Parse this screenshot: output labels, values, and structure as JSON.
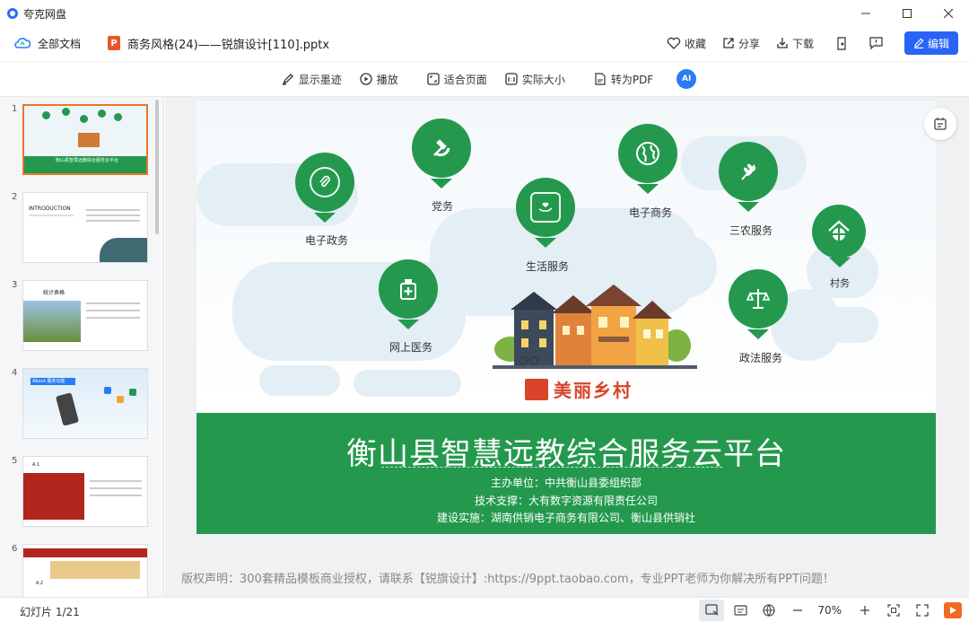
{
  "window": {
    "app_title": "夸克网盘"
  },
  "toolbar": {
    "breadcrumb": "全部文档",
    "filename": "商务风格(24)——锐旗设计[110].pptx",
    "file_type_badge": "P",
    "favorite_label": "收藏",
    "share_label": "分享",
    "download_label": "下载",
    "edit_label": "编辑"
  },
  "viewbar": {
    "ink_label": "显示墨迹",
    "play_label": "播放",
    "fit_label": "适合页面",
    "actual_label": "实际大小",
    "pdf_label": "转为PDF",
    "ai_label": "AI"
  },
  "thumbnails": [
    {
      "num": "1",
      "text": "衡山县智慧远教综合服务云平台"
    },
    {
      "num": "2",
      "text": "INTRODUCTION"
    },
    {
      "num": "3",
      "text": "统计表格"
    },
    {
      "num": "4",
      "text": "About 服务功能"
    },
    {
      "num": "5",
      "text": "A.1"
    },
    {
      "num": "6",
      "text": "A.2"
    }
  ],
  "slide": {
    "services": [
      {
        "label": "电子政务",
        "icon": "paperclip-icon"
      },
      {
        "label": "党务",
        "icon": "hammer-sickle-icon"
      },
      {
        "label": "生活服务",
        "icon": "heart-hand-icon"
      },
      {
        "label": "电子商务",
        "icon": "globe-icon"
      },
      {
        "label": "三农服务",
        "icon": "wheat-icon"
      },
      {
        "label": "村务",
        "icon": "house-icon"
      },
      {
        "label": "网上医务",
        "icon": "medicine-icon"
      },
      {
        "label": "政法服务",
        "icon": "scales-icon"
      }
    ],
    "logo_text": "美丽乡村",
    "title": "衡山县智慧远教综合服务云平台",
    "organizer": "主办单位：中共衡山县委组织部",
    "tech_support": "技术支撑：大有数字资源有限责任公司",
    "implementer": "建设实施：湖南供销电子商务有限公司、衡山县供销社",
    "brand_color": "#24994e"
  },
  "copyright": "版权声明：300套精品模板商业授权，请联系【锐旗设计】:https://9ppt.taobao.com，专业PPT老师为你解决所有PPT问题！",
  "status": {
    "slide_counter": "幻灯片 1/21",
    "zoom": "70%"
  }
}
